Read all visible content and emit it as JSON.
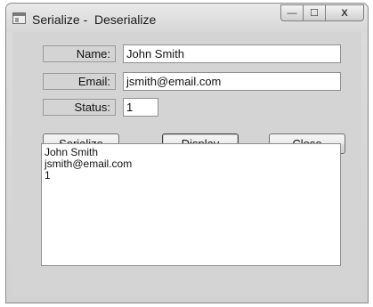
{
  "window": {
    "title": "Serialize -  Deserialize",
    "min_glyph": "—",
    "max_glyph": "☐",
    "close_glyph": "X"
  },
  "form": {
    "name_label": "Name:",
    "name_value": "John Smith",
    "email_label": "Email:",
    "email_value": "jsmith@email.com",
    "status_label": "Status:",
    "status_value": "1"
  },
  "buttons": {
    "serialize": "Serialize",
    "display": "Display",
    "close": "Close"
  },
  "output": {
    "lines": [
      "John Smith",
      "jsmith@email.com",
      "1"
    ]
  }
}
